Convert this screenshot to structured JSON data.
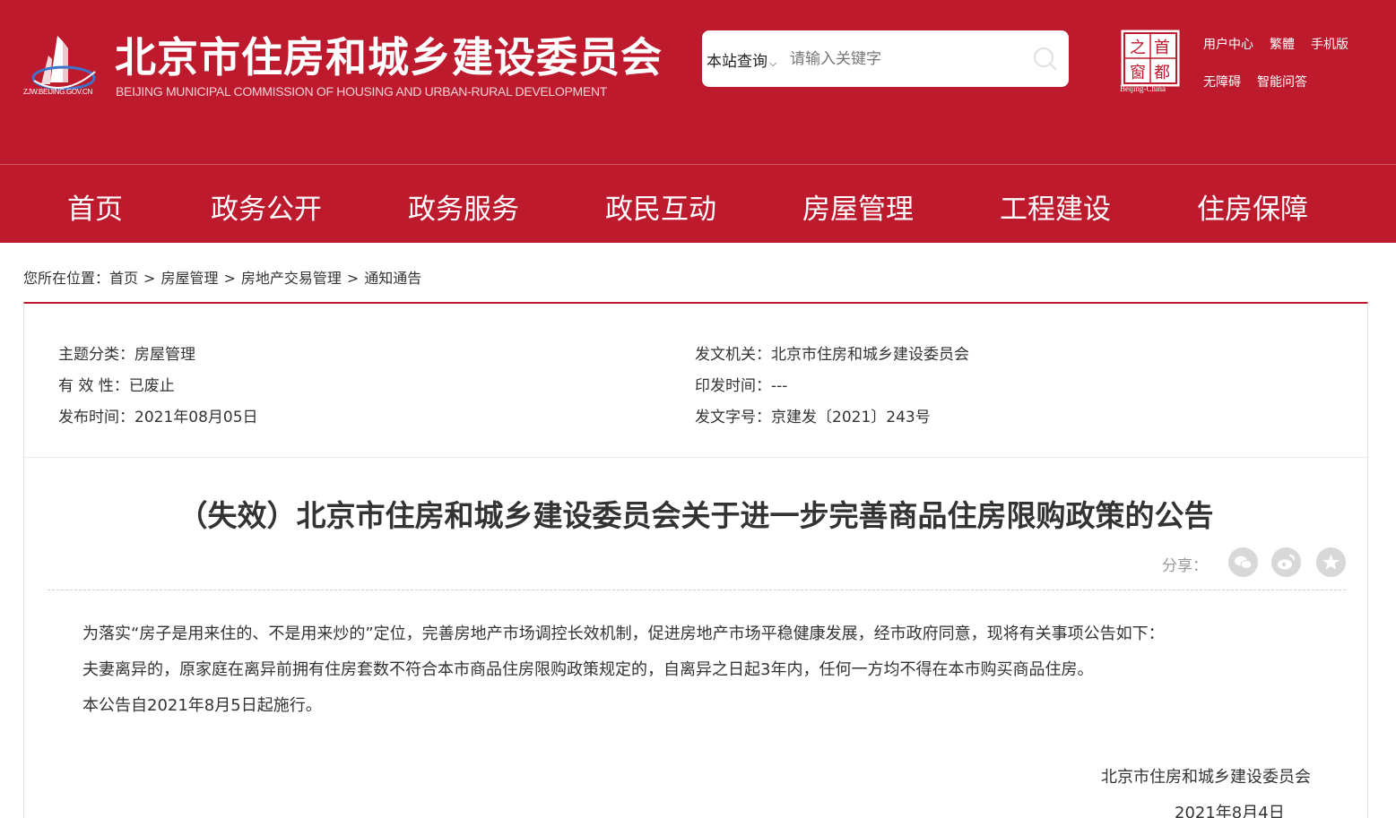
{
  "header": {
    "logo_url_text": "ZJW.BEIJING.GOV.CN",
    "title": "北京市住房和城乡建设委员会",
    "subtitle": "BEIJING MUNICIPAL COMMISSION OF HOUSING AND URBAN-RURAL DEVELOPMENT",
    "search": {
      "scope_label": "本站查询",
      "placeholder": "请输入关键字"
    },
    "capital_logo": {
      "chars": [
        "之",
        "首",
        "窗",
        "都"
      ],
      "caption": "Beijing-China"
    },
    "links": [
      "用户中心",
      "繁體",
      "手机版",
      "无障碍",
      "智能问答"
    ]
  },
  "nav": {
    "items": [
      "首页",
      "政务公开",
      "政务服务",
      "政民互动",
      "房屋管理",
      "工程建设",
      "住房保障"
    ]
  },
  "breadcrumb": {
    "prefix": "您所在位置：",
    "items": [
      "首页",
      "房屋管理",
      "房地产交易管理",
      "通知通告"
    ],
    "separator": ">"
  },
  "meta": {
    "topic": "主题分类：房屋管理",
    "validity": "有 效 性：已废止",
    "publish_date": "发布时间：2021年08月05日",
    "issuer": "发文机关：北京市住房和城乡建设委员会",
    "print_date": "印发时间：---",
    "doc_number": "发文字号：京建发〔2021〕243号"
  },
  "article": {
    "title": "（失效）北京市住房和城乡建设委员会关于进一步完善商品住房限购政策的公告",
    "share_label": "分享：",
    "share_icons": [
      "wechat-icon",
      "weibo-icon",
      "favorite-icon"
    ],
    "paragraphs": [
      "为落实“房子是用来住的、不是用来炒的”定位，完善房地产市场调控长效机制，促进房地产市场平稳健康发展，经市政府同意，现将有关事项公告如下：",
      "夫妻离异的，原家庭在离异前拥有住房套数不符合本市商品住房限购政策规定的，自离异之日起3年内，任何一方均不得在本市购买商品住房。",
      "本公告自2021年8月5日起施行。"
    ],
    "signature_org": "北京市住房和城乡建设委员会",
    "signature_date": "2021年8月4日"
  },
  "colors": {
    "brand_red": "#be1a2e",
    "text": "#333333"
  }
}
